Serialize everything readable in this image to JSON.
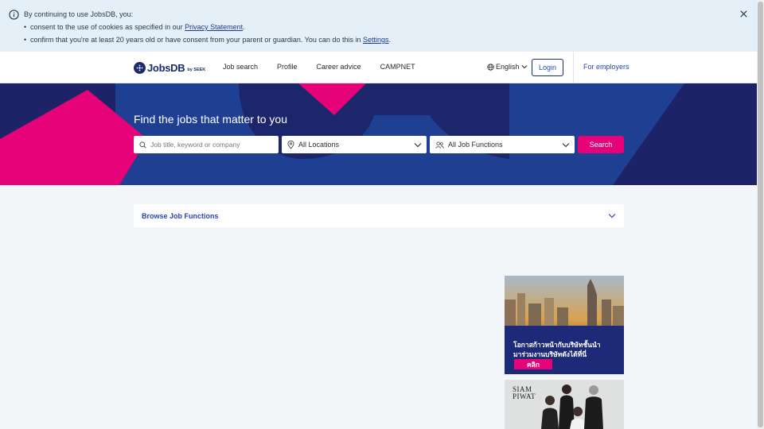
{
  "cookie_banner": {
    "intro": "By continuing to use JobsDB, you:",
    "item1_text": "consent to the use of cookies as specified in our ",
    "item1_link": "Privacy Statement",
    "item1_end": ".",
    "item2_text": "confirm that you're at least 20 years old or have consent from your parent or guardian. You can do this in ",
    "item2_link": "Settings",
    "item2_end": "."
  },
  "header": {
    "logo_word": "JobsDB",
    "logo_by": "by SEEK",
    "nav": [
      "Job search",
      "Profile",
      "Career advice",
      "CAMPNET"
    ],
    "language": "English",
    "login_label": "Login",
    "employers_label": "For employers"
  },
  "hero": {
    "title": "Find the jobs that matter to you",
    "search_placeholder": "Job title, keyword or company",
    "location_value": "All Locations",
    "function_value": "All Job Functions",
    "search_button": "Search"
  },
  "browse": {
    "label": "Browse Job Functions"
  },
  "ads": {
    "ad1_line1": "โอกาสก้าวหน้ากับบริษัทชั้นนำ",
    "ad1_line2": "มาร่วมงานบริษัทดังได้ที่นี่",
    "ad1_cta": "คลิก",
    "ad2_line1": "SIAM",
    "ad2_line2": "PIWAT"
  },
  "colors": {
    "brand_navy": "#1c2467",
    "accent_pink": "#e60278",
    "link_blue": "#2548b4"
  }
}
